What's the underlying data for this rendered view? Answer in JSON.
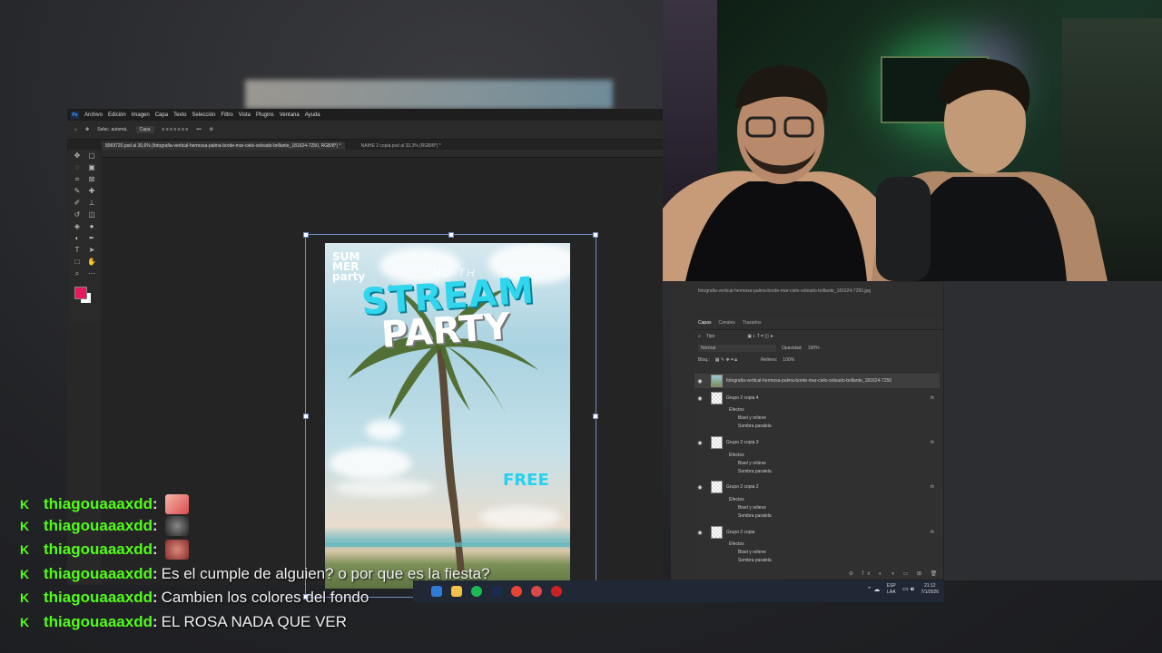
{
  "photoshop": {
    "app_logo": "Ps",
    "menu": [
      "Archivo",
      "Edición",
      "Imagen",
      "Capa",
      "Texto",
      "Selección",
      "Filtro",
      "Vista",
      "Plugins",
      "Ventana",
      "Ayuda"
    ],
    "options": {
      "auto_select_label": "Selec. automá.",
      "layer_select": "Capa"
    },
    "tabs": [
      {
        "label": "8969720.psd al 30,6% (fotografia-vertical-hermosa-palma-borde-mar-cielo-soleado-brillante_181624-7250, RGB/8*) *"
      },
      {
        "label": "NAIHE 2 copia.psd al 33,3% (RGB/8*) *"
      }
    ],
    "colors": {
      "foreground": "#e5195e",
      "background": "#ffffff"
    }
  },
  "poster": {
    "logo": "SUM\nMER\nparty",
    "subtitle": "MO TH",
    "headline_1": "STREAM",
    "headline_2": "PARTY",
    "free": "FREE"
  },
  "layers_panel": {
    "file_title": "fotografia-vertical-hermosa-palma-borde-mar-cielo-soleado-brillante_181624-7250.jpg",
    "tabs": [
      "Capas",
      "Canales",
      "Trazados"
    ],
    "filter_label": "Tipo",
    "blend_mode": "Normal",
    "opacity_label": "Opacidad:",
    "opacity_value": "100%",
    "lock_label": "Bloq.:",
    "fill_label": "Relleno:",
    "fill_value": "100%",
    "layers": [
      {
        "name": "fotografia-vertical-hermosa-palma-borde-mar-cielo-soleado-brillante_181624-7250"
      },
      {
        "name": "Grupo 2 copia 4",
        "effects": "Efectos",
        "effect_items": [
          "Bisel y relieve",
          "Sombra paralela"
        ],
        "fx": "fx"
      },
      {
        "name": "Grupo 2 copia 3",
        "effects": "Efectos",
        "effect_items": [
          "Bisel y relieve",
          "Sombra paralela"
        ],
        "fx": "fx"
      },
      {
        "name": "Grupo 2 copia 2",
        "effects": "Efectos",
        "effect_items": [
          "Bisel y relieve",
          "Sombra paralela"
        ],
        "fx": "fx"
      },
      {
        "name": "Grupo 2 copia",
        "effects": "Efectos",
        "effect_items": [
          "Bisel y relieve",
          "Sombra paralela"
        ],
        "fx": "fx"
      }
    ]
  },
  "taskbar": {
    "lang": "ESP",
    "lang2": "LAA",
    "time": "21:12",
    "date": "7/1/2026"
  },
  "chat": [
    {
      "user": "thiagouaaaxdd",
      "text": "",
      "emote": "emote-pink"
    },
    {
      "user": "thiagouaaaxdd",
      "text": "",
      "emote": "emote-face"
    },
    {
      "user": "thiagouaaaxdd",
      "text": "",
      "emote": "emote-thumb"
    },
    {
      "user": "thiagouaaaxdd",
      "text": "Es el cumple de alguien? o por que es la fiesta?"
    },
    {
      "user": "thiagouaaaxdd",
      "text": "Cambien los colores del fondo"
    },
    {
      "user": "thiagouaaaxdd",
      "text": "EL ROSA NADA QUE VER"
    }
  ]
}
